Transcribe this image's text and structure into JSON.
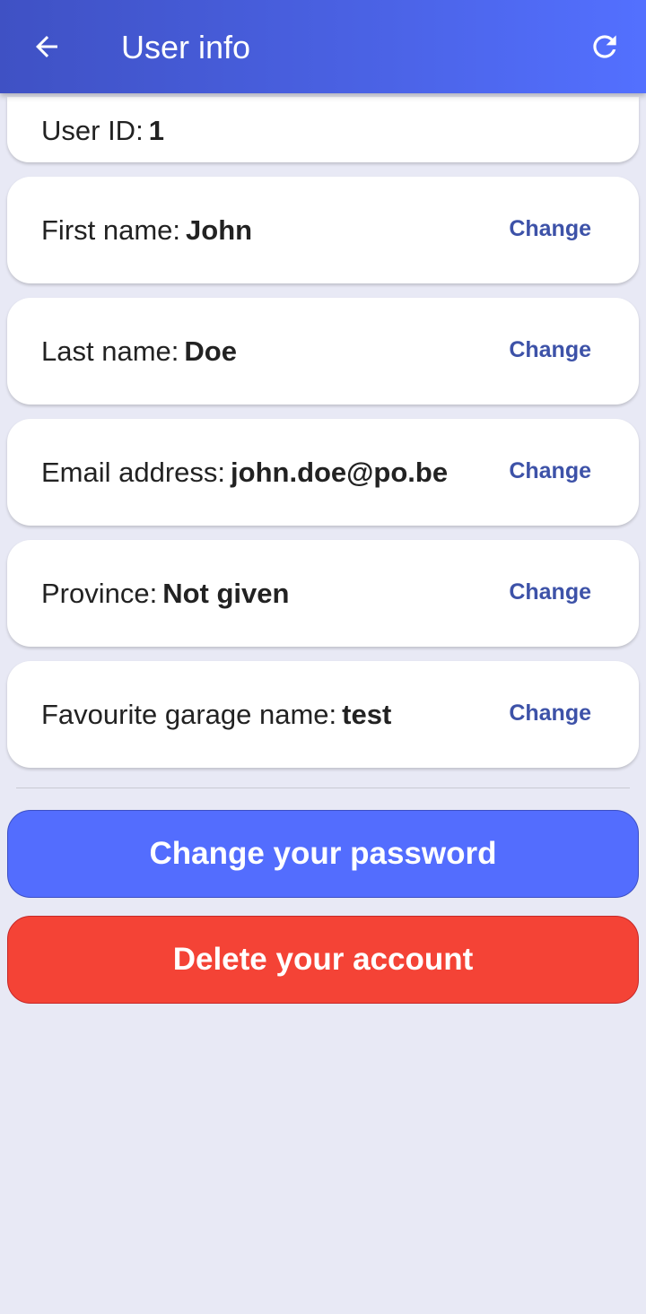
{
  "appbar": {
    "title": "User info",
    "back_icon": "arrow-back-icon",
    "refresh_icon": "refresh-icon"
  },
  "user_id": {
    "label": "User ID:",
    "value": "1"
  },
  "fields": [
    {
      "label": "First name:",
      "value": "John",
      "action": "Change"
    },
    {
      "label": "Last name:",
      "value": "Doe",
      "action": "Change"
    },
    {
      "label": "Email address:",
      "value": "john.doe@po.be",
      "action": "Change"
    },
    {
      "label": "Province:",
      "value": "Not given",
      "action": "Change"
    },
    {
      "label": "Favourite garage name:",
      "value": "test",
      "action": "Change"
    }
  ],
  "buttons": {
    "change_password": "Change your password",
    "delete_account": "Delete your account"
  },
  "colors": {
    "primary": "#536dfe",
    "danger": "#f44336",
    "link": "#3d52a8",
    "background": "#e8e9f5"
  }
}
